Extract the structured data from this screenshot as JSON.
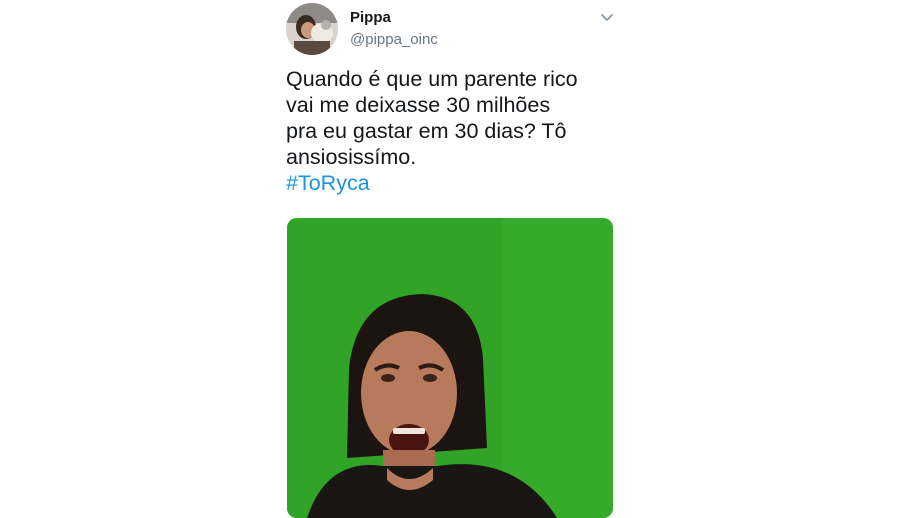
{
  "tweet": {
    "author": {
      "display_name": "Pippa",
      "handle": "@pippa_oinc",
      "avatar_icon": "avatar-photo"
    },
    "menu_icon": "chevron-down-icon",
    "text_lines": [
      "Quando é que um parente rico",
      "vai me deixasse 30 milhões",
      "pra eu gastar em 30 dias? Tô",
      "ansiosissímo."
    ],
    "hashtag": "#ToRyca",
    "media": {
      "type": "gif",
      "background_color": "#2fa623"
    }
  },
  "colors": {
    "text": "#14171a",
    "secondary": "#657786",
    "link": "#1b95e0"
  }
}
